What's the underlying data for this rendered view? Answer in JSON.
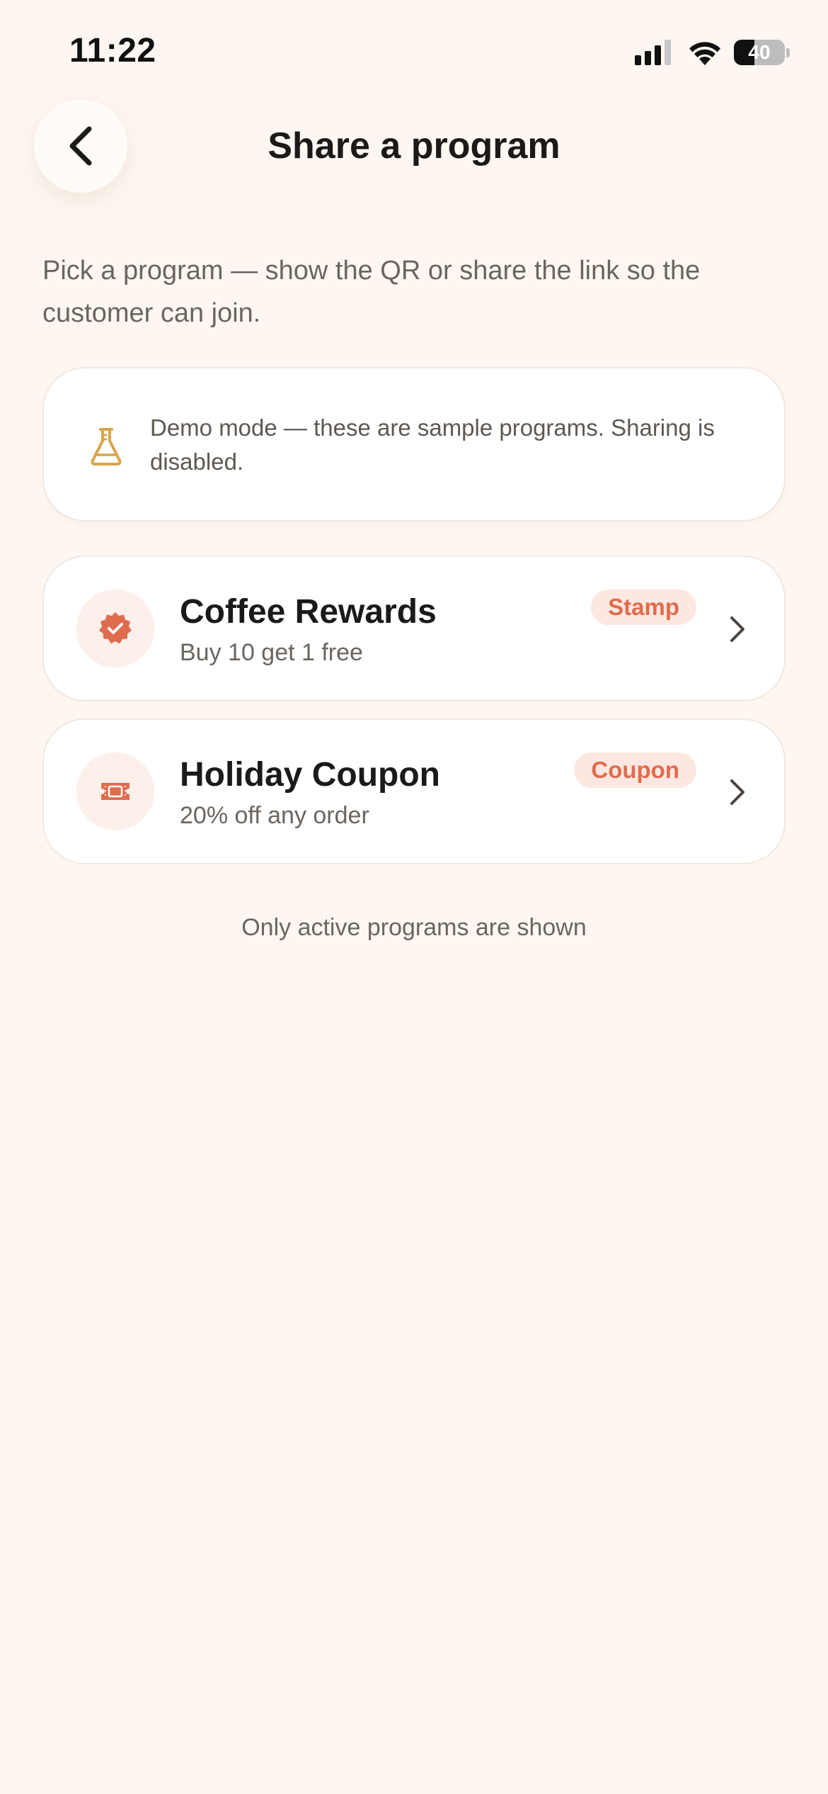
{
  "status_bar": {
    "time": "11:22",
    "battery_level": "40",
    "battery_fraction": 0.4,
    "icons": [
      "signal-icon",
      "wifi-icon",
      "battery-icon"
    ]
  },
  "header": {
    "back_icon": "chevron-left-icon",
    "title": "Share a program"
  },
  "intro": "Pick a program — show the QR or share the link so the customer can join.",
  "demo_notice": {
    "icon": "flask-icon",
    "text": "Demo mode — these are sample programs. Sharing is disabled."
  },
  "programs": [
    {
      "icon": "verified-badge-icon",
      "name": "Coffee Rewards",
      "description": "Buy 10 get 1 free",
      "type": "Stamp"
    },
    {
      "icon": "ticket-icon",
      "name": "Holiday Coupon",
      "description": "20% off any order",
      "type": "Coupon"
    }
  ],
  "footer_note": "Only active programs are shown",
  "colors": {
    "background": "#FEF7F1",
    "accent": "#E06C4E",
    "badge_bg": "#FCE8E1",
    "demo_icon": "#D8A44A",
    "text_primary": "#1C1A18",
    "text_secondary": "#6B6560"
  }
}
